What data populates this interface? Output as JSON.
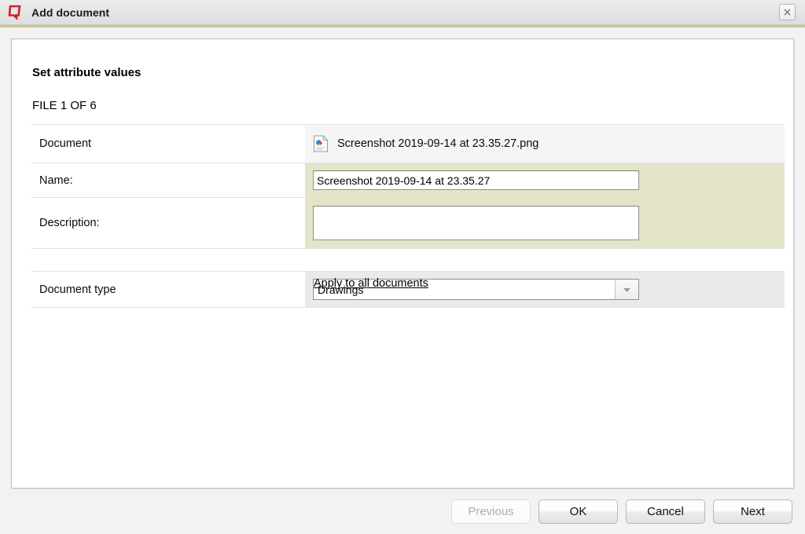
{
  "window": {
    "title": "Add document",
    "app_icon": "quadri-logo-icon",
    "close_label": "×",
    "accent_color": "#c9c894"
  },
  "content": {
    "heading": "Set attribute values",
    "file_counter": "FILE 1 OF 6"
  },
  "fields": {
    "document": {
      "label": "Document",
      "file_icon": "image-file-icon",
      "file_name": "Screenshot 2019-09-14 at 23.35.27.png"
    },
    "name": {
      "label": "Name:",
      "value": "Screenshot 2019-09-14 at 23.35.27",
      "placeholder": ""
    },
    "description": {
      "label": "Description:",
      "value": "",
      "placeholder": ""
    },
    "document_type": {
      "label": "Document type",
      "value": "Drawings",
      "arrow_icon": "chevron-down-icon"
    }
  },
  "links": {
    "apply_to_all": "Apply to all documents"
  },
  "footer": {
    "previous": "Previous",
    "ok": "OK",
    "cancel": "Cancel",
    "next": "Next"
  }
}
